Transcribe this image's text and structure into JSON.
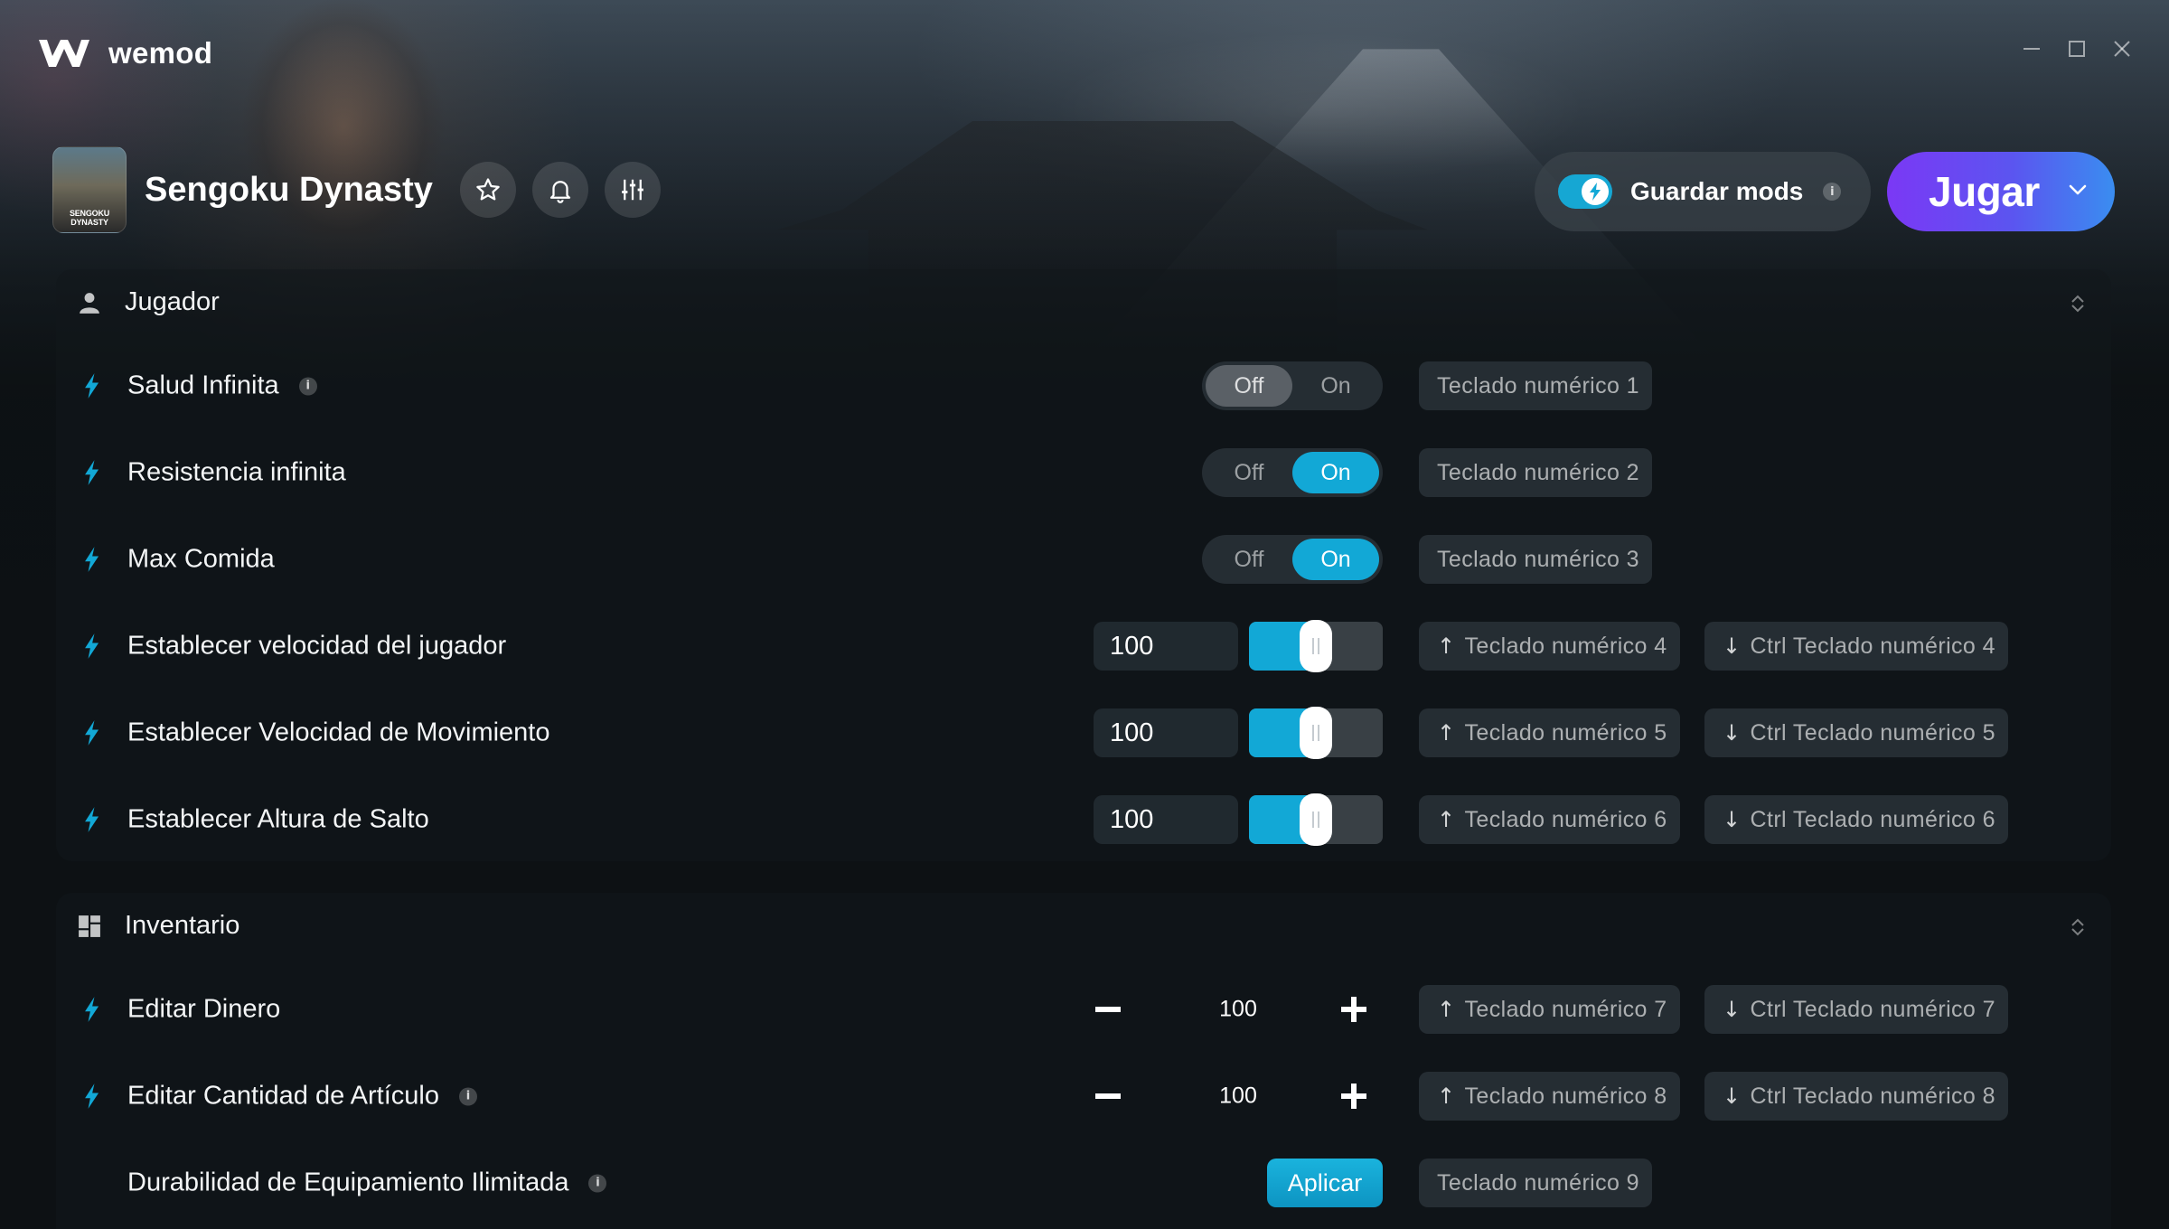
{
  "app": {
    "name": "wemod"
  },
  "game": {
    "title": "Sengoku Dynasty",
    "cover_text": "SENGOKU DYNASTY"
  },
  "header": {
    "save_mods_label": "Guardar mods",
    "info_glyph": "i",
    "play_label": "Jugar"
  },
  "colors": {
    "accent": "#12a8d6",
    "play_start": "#7b38f5",
    "play_end": "#3a8df0"
  },
  "sections": [
    {
      "title": "Jugador",
      "icon": "person-icon",
      "rows": [
        {
          "name": "Salud Infinita",
          "info": true,
          "type": "toggle",
          "state": "Off",
          "off_label": "Off",
          "on_label": "On",
          "hotkey": "Teclado numérico 1"
        },
        {
          "name": "Resistencia infinita",
          "info": false,
          "type": "toggle",
          "state": "On",
          "off_label": "Off",
          "on_label": "On",
          "hotkey": "Teclado numérico 2"
        },
        {
          "name": "Max Comida",
          "info": false,
          "type": "toggle",
          "state": "On",
          "off_label": "Off",
          "on_label": "On",
          "hotkey": "Teclado numérico 3"
        },
        {
          "name": "Establecer velocidad del jugador",
          "type": "slider",
          "value": "100",
          "fill": 0.5,
          "hotkey_up": "Teclado numérico 4",
          "hotkey_down": "Ctrl Teclado numérico 4"
        },
        {
          "name": "Establecer Velocidad de Movimiento",
          "type": "slider",
          "value": "100",
          "fill": 0.5,
          "hotkey_up": "Teclado numérico 5",
          "hotkey_down": "Ctrl Teclado numérico 5"
        },
        {
          "name": "Establecer Altura de Salto",
          "type": "slider",
          "value": "100",
          "fill": 0.5,
          "hotkey_up": "Teclado numérico 6",
          "hotkey_down": "Ctrl Teclado numérico 6"
        }
      ]
    },
    {
      "title": "Inventario",
      "icon": "grid-icon",
      "rows": [
        {
          "name": "Editar Dinero",
          "info": false,
          "type": "stepper",
          "value": "100",
          "hotkey_up": "Teclado numérico 7",
          "hotkey_down": "Ctrl Teclado numérico 7"
        },
        {
          "name": "Editar Cantidad de Artículo",
          "info": true,
          "type": "stepper",
          "value": "100",
          "hotkey_up": "Teclado numérico 8",
          "hotkey_down": "Ctrl Teclado numérico 8"
        },
        {
          "name": "Durabilidad de Equipamiento Ilimitada",
          "info": true,
          "type": "button",
          "button_label": "Aplicar",
          "hotkey": "Teclado numérico 9"
        }
      ]
    }
  ]
}
